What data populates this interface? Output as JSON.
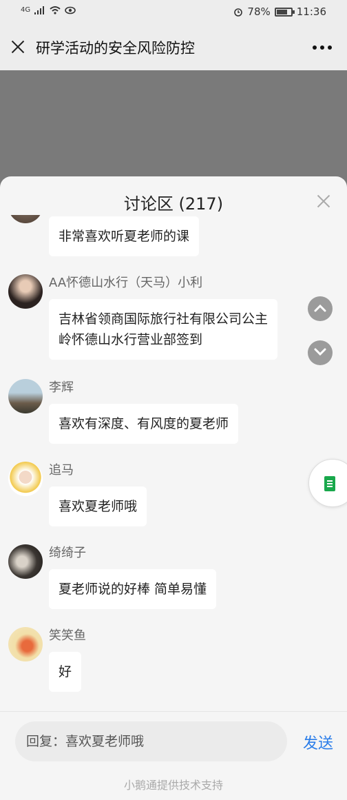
{
  "status": {
    "network": "4G",
    "battery_text": "78%",
    "battery_level": 0.78,
    "time": "11:36"
  },
  "header": {
    "title": "研学活动的安全风险防控"
  },
  "panel": {
    "title": "讨论区 (217)",
    "messages": [
      {
        "sender": "",
        "text": "非常喜欢听夏老师的课"
      },
      {
        "sender": "AA怀德山水行（天马）小利",
        "text_line1": "吉林省领商国际旅行社有限公司公主",
        "text_line2": "岭怀德山水行营业部签到"
      },
      {
        "sender": "李辉",
        "text": "喜欢有深度、有风度的夏老师"
      },
      {
        "sender": "追马",
        "text": "喜欢夏老师哦"
      },
      {
        "sender": "绮绮子",
        "text": "夏老师说的好棒 简单易懂"
      },
      {
        "sender": "笑笑鱼",
        "text": "好"
      }
    ]
  },
  "reply": {
    "placeholder": "回复：喜欢夏老师哦",
    "send_label": "发送"
  },
  "footer": {
    "support": "小鹅通提供技术支持"
  }
}
